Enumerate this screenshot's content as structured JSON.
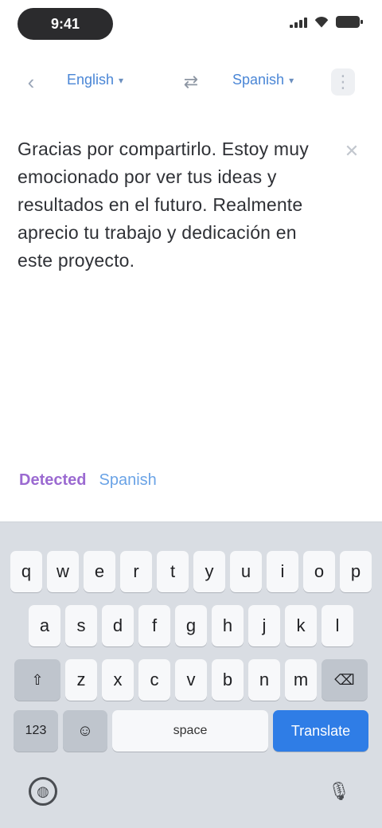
{
  "status_bar": {
    "time": "9:41"
  },
  "toolbar": {
    "back_icon": "chevron-left-icon",
    "source_language": "English",
    "swap_icon": "swap-icon",
    "target_language": "Spanish",
    "more_icon": "more-icon"
  },
  "input": {
    "text": "Gracias por compartirlo. Estoy muy emocionado por ver tus ideas y resultados en el futuro. Realmente aprecio tu trabajo y dedicación en este proyecto."
  },
  "suggestion": {
    "label": "Detected",
    "value": "Spanish"
  },
  "keyboard": {
    "row1": [
      "q",
      "w",
      "e",
      "r",
      "t",
      "y",
      "u",
      "i",
      "o",
      "p"
    ],
    "row2": [
      "a",
      "s",
      "d",
      "f",
      "g",
      "h",
      "j",
      "k",
      "l"
    ],
    "row3": [
      "z",
      "x",
      "c",
      "v",
      "b",
      "n",
      "m"
    ],
    "shift_label": "⇧",
    "delete_label": "⌫",
    "numbers_label": "123",
    "emoji_label": "☺",
    "space_label": "space",
    "return_label": "Translate"
  },
  "colors": {
    "accent": "#2f7de6",
    "language_link": "#4a86d6",
    "suggestion_label": "#9b6ad1"
  }
}
